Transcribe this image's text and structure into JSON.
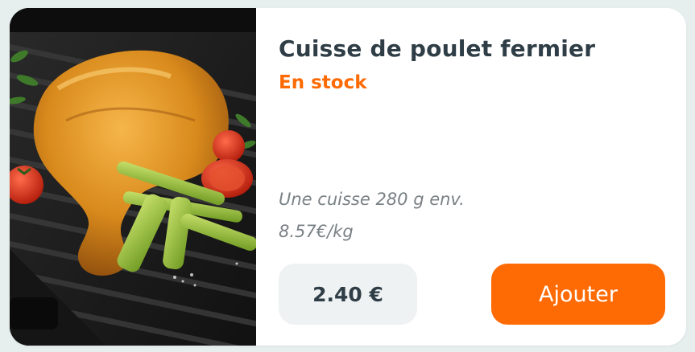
{
  "product": {
    "title": "Cuisse de poulet fermier",
    "availability": "En stock",
    "description_line1": "Une cuisse 280 g env.",
    "description_line2": "8.57€/kg",
    "price": "2.40 €",
    "add_button_label": "Ajouter",
    "image_icon": "chicken-leg-photo"
  },
  "colors": {
    "accent": "#fe6b05",
    "title": "#2f3e46",
    "price_bg": "#eef2f3",
    "description": "#7a8185"
  }
}
